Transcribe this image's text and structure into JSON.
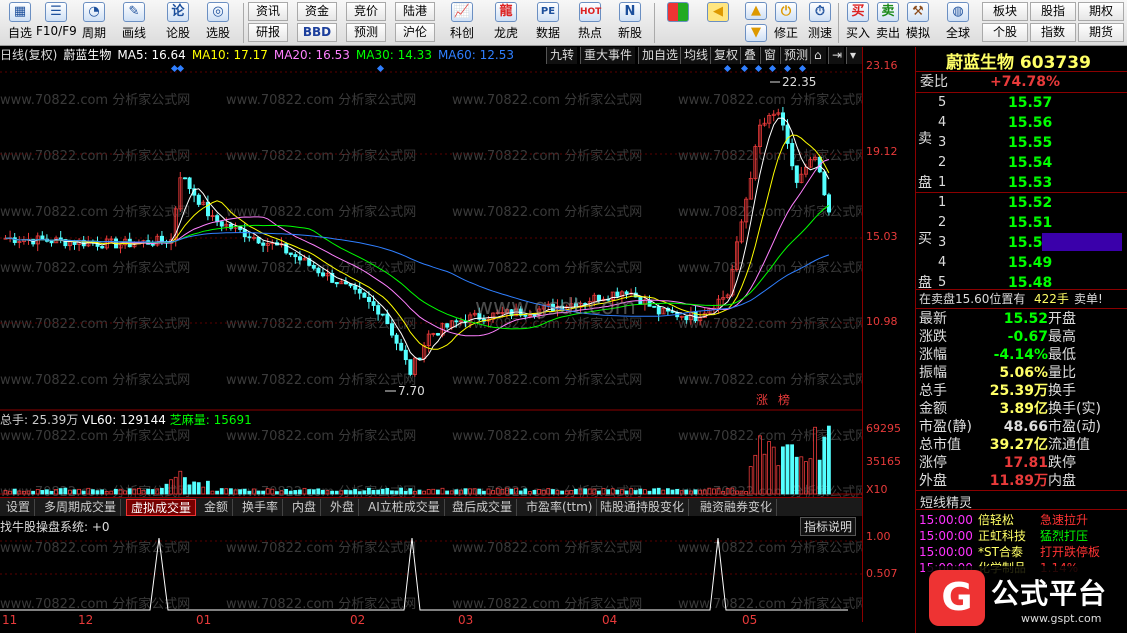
{
  "toolbar": {
    "left_buttons": [
      {
        "label": "自选",
        "icon": "grid-icon"
      },
      {
        "label": "F10/F9",
        "icon": "document-icon"
      },
      {
        "label": "周期",
        "icon": "clock-icon"
      },
      {
        "label": "画线",
        "icon": "pencil-icon"
      },
      {
        "label": "论股",
        "icon": "forum-icon"
      },
      {
        "label": "选股",
        "icon": "radar-icon"
      }
    ],
    "small_buttons": [
      {
        "label": "资讯"
      },
      {
        "label": "资金"
      },
      {
        "label": "竞价"
      },
      {
        "label": "陆港"
      },
      {
        "label": "研报"
      },
      {
        "label": "BBD"
      },
      {
        "label": "预测"
      },
      {
        "label": "沪伦"
      }
    ],
    "mid_buttons": [
      {
        "label": "科创",
        "icon": "chart-icon"
      },
      {
        "label": "龙虎",
        "icon": "dragon-icon"
      },
      {
        "label": "数据",
        "icon": "pe-icon"
      },
      {
        "label": "热点",
        "icon": "hot-icon"
      },
      {
        "label": "新股",
        "icon": "new-stock-icon"
      }
    ],
    "right_buttons": [
      {
        "label": "",
        "icon": "tiles-icon"
      },
      {
        "label": "",
        "icon": "arrow-left-icon"
      },
      {
        "label": "",
        "icon": "arrow-up-icon"
      },
      {
        "label": "修正",
        "icon": "power-icon"
      },
      {
        "label": "测速",
        "icon": "stopwatch-icon"
      },
      {
        "label": "买入",
        "icon": "buy-icon"
      },
      {
        "label": "卖出",
        "icon": "sell-icon"
      },
      {
        "label": "模拟",
        "icon": "gavel-icon"
      },
      {
        "label": "全球",
        "icon": "globe-icon"
      }
    ],
    "far_right": [
      {
        "label": "板块"
      },
      {
        "label": "股指"
      },
      {
        "label": "期权"
      },
      {
        "label": "个股"
      },
      {
        "label": "指数"
      },
      {
        "label": "期货"
      }
    ]
  },
  "infobar": {
    "period": "日线(复权)",
    "stock": "蔚蓝生物",
    "ma5": "MA5: 16.64",
    "ma10": "MA10: 17.17",
    "ma20": "MA20: 16.53",
    "ma30": "MA30: 14.33",
    "ma60": "MA60: 12.53"
  },
  "chart_tabs": [
    "九转",
    "重大事件",
    "加自选",
    "均线",
    "复权",
    "叠",
    "窗",
    "预测"
  ],
  "right_axis": {
    "price": [
      "23.16",
      "19.12",
      "15.03",
      "10.98"
    ],
    "volume": [
      "69295",
      "35165",
      "X10"
    ],
    "indicator": [
      "1.00",
      "0.507"
    ]
  },
  "annotations": {
    "high": "22.35",
    "low": "7.70",
    "limit_up": "涨",
    "rank": "榜",
    "watermark_center": "www.gsdt.com",
    "watermark_grid": "www.70822.com 分析家公式网"
  },
  "volume_bar": {
    "label": "总手: 25.39万",
    "vl60": "VL60: 129144",
    "sesame": "芝麻量: 15691"
  },
  "bottom_tabs": [
    "设置",
    "多周期成交量",
    "虚拟成交量",
    "金额",
    "换手率",
    "内盘",
    "外盘",
    "AI立桩成交量",
    "盘后成交量",
    "市盈率(ttm)",
    "陆股通持股变化",
    "融资融券变化"
  ],
  "active_bottom_tab": "虚拟成交量",
  "indicator": {
    "name": "找牛股操盘系统: +0",
    "help": "指标说明"
  },
  "x_axis": [
    "11",
    "12",
    "01",
    "02",
    "03",
    "04",
    "05"
  ],
  "quote": {
    "name": "蔚蓝生物",
    "code": "603739",
    "weibi_label": "委比",
    "weibi": "+74.78%",
    "sell_side": "卖盘",
    "buy_side": "买盘",
    "asks": [
      {
        "lv": "5",
        "p": "15.57"
      },
      {
        "lv": "4",
        "p": "15.56"
      },
      {
        "lv": "3",
        "p": "15.55"
      },
      {
        "lv": "2",
        "p": "15.54"
      },
      {
        "lv": "1",
        "p": "15.53"
      }
    ],
    "bids": [
      {
        "lv": "1",
        "p": "15.52"
      },
      {
        "lv": "2",
        "p": "15.51"
      },
      {
        "lv": "3",
        "p": "15.50"
      },
      {
        "lv": "4",
        "p": "15.49"
      },
      {
        "lv": "5",
        "p": "15.48"
      }
    ],
    "notice": "在卖盘15.60位置有",
    "notice_qty": "422手",
    "notice_tail": "卖单!",
    "stats": [
      {
        "l": "最新",
        "v": "15.52",
        "r": "开盘"
      },
      {
        "l": "涨跌",
        "v": "-0.67",
        "r": "最高"
      },
      {
        "l": "涨幅",
        "v": "-4.14%",
        "r": "最低"
      },
      {
        "l": "振幅",
        "v": "5.06%",
        "r": "量比"
      },
      {
        "l": "总手",
        "v": "25.39万",
        "r": "换手"
      },
      {
        "l": "金额",
        "v": "3.89亿",
        "r": "换手(实)"
      },
      {
        "l": "市盈(静)",
        "v": "48.66",
        "r": "市盈(动)"
      },
      {
        "l": "总市值",
        "v": "39.27亿",
        "r": "流通值"
      },
      {
        "l": "涨停",
        "v": "17.81",
        "r": "跌停"
      },
      {
        "l": "外盘",
        "v": "11.89万",
        "r": "内盘"
      }
    ],
    "sprite_title": "短线精灵",
    "sprites": [
      {
        "t": "15:00:00",
        "n": "倍轻松",
        "e": "急速拉升"
      },
      {
        "t": "15:00:00",
        "n": "正虹科技",
        "e": "猛烈打压"
      },
      {
        "t": "15:00:00",
        "n": "*ST合泰",
        "e": "打开跌停板"
      },
      {
        "t": "15:00:00",
        "n": "化学制品",
        "e": "1.14%"
      }
    ]
  },
  "logo": {
    "text": "公式平台",
    "url": "www.gspt.com"
  },
  "colors": {
    "up": "#e83a3a",
    "down": "#54ffff",
    "ma5": "#ffffff",
    "ma10": "#ffff00",
    "ma20": "#ff80ff",
    "ma30": "#00ff00",
    "ma60": "#2f7fff"
  }
}
